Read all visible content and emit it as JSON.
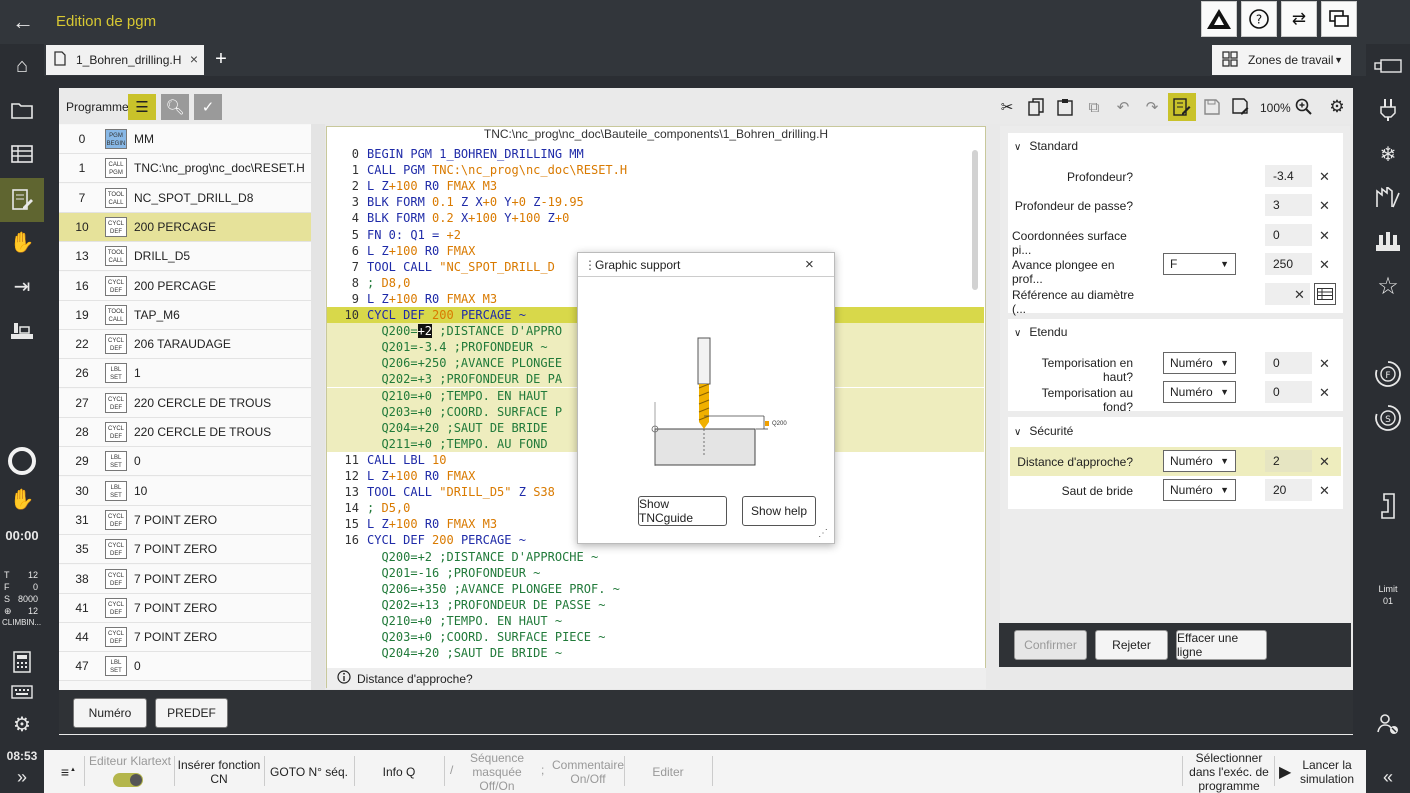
{
  "header": {
    "title": "Edition de pgm",
    "back_icon": "←",
    "icons": [
      "warning-icon",
      "help-icon",
      "transfer-icon",
      "windows-icon"
    ]
  },
  "tabs": {
    "file_tab": "1_Bohren_drilling.H",
    "add": "+",
    "close": "×",
    "workspaces": "Zones de travail"
  },
  "left_sidebar": {
    "time": "00:00",
    "status": {
      "t": "T",
      "t_val": "12",
      "f": "F",
      "f_val": "0",
      "s": "S",
      "s_val": "8000",
      "spindle": "12",
      "mode": "CLIMBIN..."
    },
    "clock": "08:53",
    "expand": "»"
  },
  "right_sidebar": {
    "limit_label": "Limit",
    "limit_value": "01",
    "collapse": "«"
  },
  "program_panel": {
    "label": "Programme",
    "rows": [
      {
        "num": "0",
        "badge1": "PGM",
        "badge2": "BEGIN",
        "text": "MM",
        "blue": true
      },
      {
        "num": "1",
        "badge1": "CALL",
        "badge2": "PGM",
        "text": "TNC:\\nc_prog\\nc_doc\\RESET.H"
      },
      {
        "num": "7",
        "badge1": "TOOL",
        "badge2": "CALL",
        "text": "NC_SPOT_DRILL_D8"
      },
      {
        "num": "10",
        "badge1": "CYCL",
        "badge2": "DEF",
        "text": "200 PERCAGE",
        "selected": true
      },
      {
        "num": "13",
        "badge1": "TOOL",
        "badge2": "CALL",
        "text": "DRILL_D5"
      },
      {
        "num": "16",
        "badge1": "CYCL",
        "badge2": "DEF",
        "text": "200 PERCAGE"
      },
      {
        "num": "19",
        "badge1": "TOOL",
        "badge2": "CALL",
        "text": "TAP_M6"
      },
      {
        "num": "22",
        "badge1": "CYCL",
        "badge2": "DEF",
        "text": "206 TARAUDAGE"
      },
      {
        "num": "26",
        "badge1": "LBL",
        "badge2": "SET",
        "text": "1"
      },
      {
        "num": "27",
        "badge1": "CYCL",
        "badge2": "DEF",
        "text": "220 CERCLE DE TROUS"
      },
      {
        "num": "28",
        "badge1": "CYCL",
        "badge2": "DEF",
        "text": "220 CERCLE DE TROUS"
      },
      {
        "num": "29",
        "badge1": "LBL",
        "badge2": "SET",
        "text": "0"
      },
      {
        "num": "30",
        "badge1": "LBL",
        "badge2": "SET",
        "text": "10"
      },
      {
        "num": "31",
        "badge1": "CYCL",
        "badge2": "DEF",
        "text": "7 POINT ZERO"
      },
      {
        "num": "35",
        "badge1": "CYCL",
        "badge2": "DEF",
        "text": "7 POINT ZERO"
      },
      {
        "num": "38",
        "badge1": "CYCL",
        "badge2": "DEF",
        "text": "7 POINT ZERO"
      },
      {
        "num": "41",
        "badge1": "CYCL",
        "badge2": "DEF",
        "text": "7 POINT ZERO"
      },
      {
        "num": "44",
        "badge1": "CYCL",
        "badge2": "DEF",
        "text": "7 POINT ZERO"
      },
      {
        "num": "47",
        "badge1": "LBL",
        "badge2": "SET",
        "text": "0"
      }
    ]
  },
  "toolbar": {
    "zoom": "100%"
  },
  "editor": {
    "path": "TNC:\\nc_prog\\nc_doc\\Bauteile_components\\1_Bohren_drilling.H",
    "lines": [
      {
        "n": "0",
        "t": "BEGIN PGM 1_BOHREN_DRILLING MM"
      },
      {
        "n": "1",
        "t": "CALL PGM TNC:\\nc_prog\\nc_doc\\RESET.H"
      },
      {
        "n": "2",
        "t": "L Z+100 R0 FMAX M3"
      },
      {
        "n": "3",
        "t": "BLK FORM 0.1 Z X+0 Y+0 Z-19.95"
      },
      {
        "n": "4",
        "t": "BLK FORM 0.2 X+100 Y+100 Z+0"
      },
      {
        "n": "5",
        "t": "FN 0: Q1 = +2"
      },
      {
        "n": "6",
        "t": "L Z+100 R0 FMAX"
      },
      {
        "n": "7",
        "t": "TOOL CALL \"NC_SPOT_DRILL_D"
      },
      {
        "n": "8",
        "t": "; D8,0"
      },
      {
        "n": "9",
        "t": "L Z+100 R0 FMAX M3"
      },
      {
        "n": "10",
        "t": "CYCL DEF 200 PERCAGE ~"
      },
      {
        "n": "",
        "t": "  Q200=+2 ;DISTANCE D'APPRO"
      },
      {
        "n": "",
        "t": "  Q201=-3.4 ;PROFONDEUR ~"
      },
      {
        "n": "",
        "t": "  Q206=+250 ;AVANCE PLONGEE"
      },
      {
        "n": "",
        "t": "  Q202=+3 ;PROFONDEUR DE PA"
      },
      {
        "n": "",
        "t": "  Q210=+0 ;TEMPO. EN HAUT"
      },
      {
        "n": "",
        "t": "  Q203=+0 ;COORD. SURFACE P"
      },
      {
        "n": "",
        "t": "  Q204=+20 ;SAUT DE BRIDE"
      },
      {
        "n": "",
        "t": "  Q211=+0 ;TEMPO. AU FOND"
      },
      {
        "n": "11",
        "t": "CALL LBL 10"
      },
      {
        "n": "12",
        "t": "L Z+100 R0 FMAX"
      },
      {
        "n": "13",
        "t": "TOOL CALL \"DRILL_D5\" Z S38"
      },
      {
        "n": "14",
        "t": "; D5,0"
      },
      {
        "n": "15",
        "t": "L Z+100 R0 FMAX M3"
      },
      {
        "n": "16",
        "t": "CYCL DEF 200 PERCAGE ~"
      },
      {
        "n": "",
        "t": "  Q200=+2 ;DISTANCE D'APPROCHE ~"
      },
      {
        "n": "",
        "t": "  Q201=-16 ;PROFONDEUR ~"
      },
      {
        "n": "",
        "t": "  Q206=+350 ;AVANCE PLONGEE PROF. ~"
      },
      {
        "n": "",
        "t": "  Q202=+13 ;PROFONDEUR DE PASSE ~"
      },
      {
        "n": "",
        "t": "  Q210=+0 ;TEMPO. EN HAUT ~"
      },
      {
        "n": "",
        "t": "  Q203=+0 ;COORD. SURFACE PIECE ~"
      },
      {
        "n": "",
        "t": "  Q204=+20 ;SAUT DE BRIDE ~"
      }
    ],
    "info": "Distance d'approche?"
  },
  "popup": {
    "title": "Graphic support",
    "close": "×",
    "q_label": "Q200",
    "btn_guide": "Show TNCguide",
    "btn_help": "Show help"
  },
  "form": {
    "standard": {
      "title": "Standard",
      "rows": [
        {
          "label": "Profondeur?",
          "value": "-3.4"
        },
        {
          "label": "Profondeur de passe?",
          "value": "3"
        },
        {
          "label": "Coordonnées surface pi...",
          "value": "0"
        },
        {
          "label": "Avance plongee en prof...",
          "select": "F",
          "value": "250"
        },
        {
          "label": "Référence au diamètre (...",
          "value": ""
        }
      ]
    },
    "etendu": {
      "title": "Etendu",
      "rows": [
        {
          "label": "Temporisation en haut?",
          "select": "Numéro",
          "value": "0"
        },
        {
          "label": "Temporisation au fond?",
          "select": "Numéro",
          "value": "0"
        }
      ]
    },
    "securite": {
      "title": "Sécurité",
      "rows": [
        {
          "label": "Distance d'approche?",
          "select": "Numéro",
          "value": "2"
        },
        {
          "label": "Saut de bride",
          "select": "Numéro",
          "value": "20"
        }
      ]
    },
    "buttons": {
      "confirm": "Confirmer",
      "reject": "Rejeter",
      "clear": "Effacer une ligne"
    }
  },
  "bottom_buttons": {
    "numero": "Numéro",
    "predef": "PREDEF"
  },
  "softkeys": {
    "menu": "≡",
    "editor_klartext": "Editeur Klartext",
    "insert_nc": "Insérer fonction CN",
    "goto": "GOTO N° séq.",
    "info_q": "Info Q",
    "seq_masked": "Séquence masquée Off/On",
    "comment": "Commentaire On/Off",
    "edit": "Editer",
    "select_exec": "Sélectionner dans l'exéc. de programme",
    "launch_sim": "Lancer la simulation"
  },
  "colors": {
    "accent": "#d7c832",
    "selected_row": "#e6e29a",
    "highlight": "#eeedbe",
    "active_tool": "#c9c22a"
  }
}
